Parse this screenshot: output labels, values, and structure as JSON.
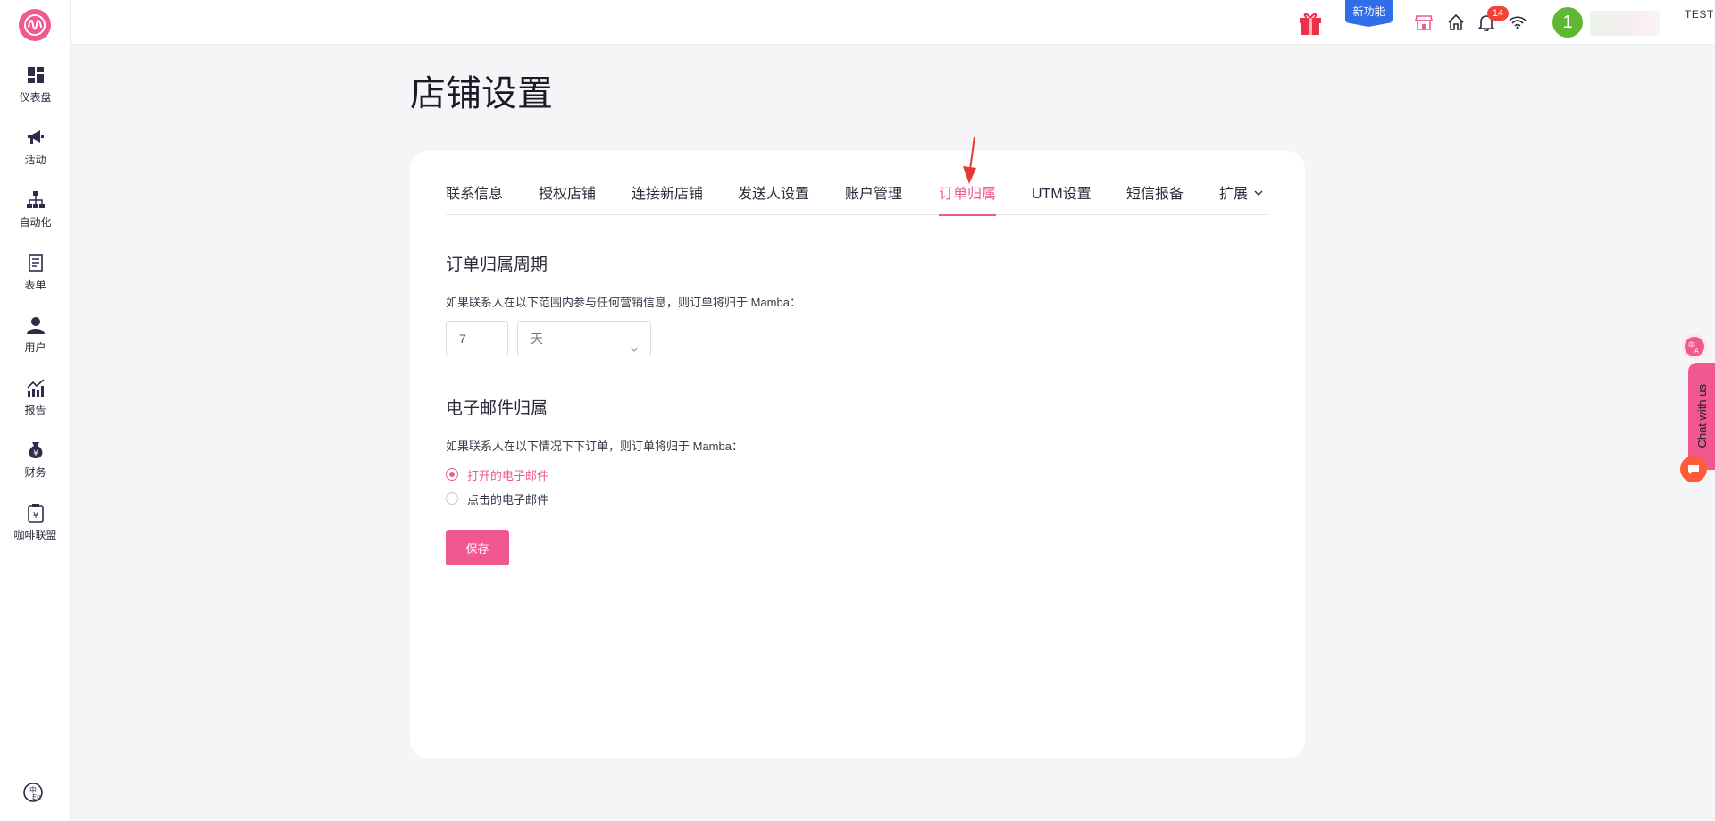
{
  "sidebar": {
    "logo_icon": "mamba-logo-icon",
    "items": [
      {
        "label": "仪表盘",
        "icon": "dashboard-icon"
      },
      {
        "label": "活动",
        "icon": "megaphone-icon"
      },
      {
        "label": "自动化",
        "icon": "hierarchy-icon"
      },
      {
        "label": "表单",
        "icon": "form-icon"
      },
      {
        "label": "用户",
        "icon": "user-icon"
      },
      {
        "label": "报告",
        "icon": "chart-icon"
      },
      {
        "label": "财务",
        "icon": "money-bag-icon"
      },
      {
        "label": "咖啡联盟",
        "icon": "clipboard-yen-icon"
      }
    ],
    "bottom_icon": "language-switch-icon"
  },
  "header": {
    "new_feature_label": "新功能",
    "notification_count": "14",
    "avatar_initial": "1",
    "user_name": "TEST",
    "icons": [
      "gift-icon",
      "store-icon",
      "home-icon",
      "bell-icon",
      "wifi-icon",
      "chevron-down-icon"
    ]
  },
  "page": {
    "title": "店铺设置",
    "tabs": [
      {
        "label": "联系信息",
        "active": false
      },
      {
        "label": "授权店铺",
        "active": false
      },
      {
        "label": "连接新店铺",
        "active": false
      },
      {
        "label": "发送人设置",
        "active": false
      },
      {
        "label": "账户管理",
        "active": false
      },
      {
        "label": "订单归属",
        "active": true
      },
      {
        "label": "UTM设置",
        "active": false
      },
      {
        "label": "短信报备",
        "active": false
      },
      {
        "label": "扩展",
        "active": false
      }
    ],
    "period_section": {
      "title": "订单归属周期",
      "description": "如果联系人在以下范围内参与任何营销信息，则订单将归于 Mamba：",
      "value": "7",
      "unit": "天"
    },
    "email_section": {
      "title": "电子邮件归属",
      "description": "如果联系人在以下情况下下订单，则订单将归于 Mamba：",
      "options": [
        {
          "label": "打开的电子邮件",
          "checked": true
        },
        {
          "label": "点击的电子邮件",
          "checked": false
        }
      ]
    },
    "save_label": "保存"
  },
  "floating": {
    "chat_label": "Chat with us"
  },
  "colors": {
    "accent": "#f0588f",
    "badge_blue": "#2f6ee8",
    "notification_red": "#f44336",
    "avatar_green": "#5fb834"
  }
}
